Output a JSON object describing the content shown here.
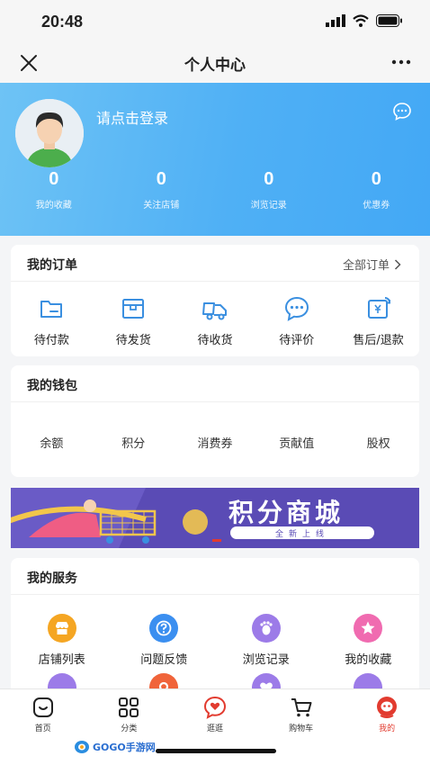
{
  "status_bar": {
    "time": "20:48"
  },
  "nav": {
    "title": "个人中心"
  },
  "profile": {
    "login_prompt": "请点击登录",
    "stats": [
      {
        "value": "0",
        "label": "我的收藏"
      },
      {
        "value": "0",
        "label": "关注店铺"
      },
      {
        "value": "0",
        "label": "浏览记录"
      },
      {
        "value": "0",
        "label": "优惠券"
      }
    ]
  },
  "orders": {
    "title": "我的订单",
    "all_link": "全部订单",
    "items": [
      {
        "label": "待付款",
        "icon": "wallet-icon"
      },
      {
        "label": "待发货",
        "icon": "package-icon"
      },
      {
        "label": "待收货",
        "icon": "truck-icon"
      },
      {
        "label": "待评价",
        "icon": "comment-icon"
      },
      {
        "label": "售后/退款",
        "icon": "refund-icon"
      }
    ]
  },
  "wallet": {
    "title": "我的钱包",
    "items": [
      "余额",
      "积分",
      "消费券",
      "贡献值",
      "股权"
    ]
  },
  "banner": {
    "title": "积分商城",
    "subtitle": "全新上线"
  },
  "services": {
    "title": "我的服务",
    "items": [
      {
        "label": "店铺列表",
        "icon": "store-icon",
        "color": "#f5a623"
      },
      {
        "label": "问题反馈",
        "icon": "question-icon",
        "color": "#3b8ff0"
      },
      {
        "label": "浏览记录",
        "icon": "footprint-icon",
        "color": "#9c7be8"
      },
      {
        "label": "我的收藏",
        "icon": "star-icon",
        "color": "#f06bb0"
      }
    ],
    "partial_icons": [
      {
        "icon": "footprint-icon",
        "color": "#9c7be8"
      },
      {
        "icon": "location-icon",
        "color": "#f0643a"
      },
      {
        "icon": "heart-icon",
        "color": "#9c7be8"
      },
      {
        "icon": "footprint-icon",
        "color": "#9c7be8"
      }
    ]
  },
  "tabbar": {
    "items": [
      {
        "label": "首页",
        "icon": "home-icon"
      },
      {
        "label": "分类",
        "icon": "category-icon"
      },
      {
        "label": "逛逛",
        "icon": "browse-icon"
      },
      {
        "label": "购物车",
        "icon": "cart-icon"
      },
      {
        "label": "我的",
        "icon": "user-icon",
        "active": true
      }
    ]
  },
  "watermark": {
    "text": "GOGO手游网"
  },
  "colors": {
    "accent": "#3a8fe0",
    "header_gradient_start": "#6ec3f5",
    "header_gradient_end": "#43a8f5",
    "active_tab": "#e23b2f"
  }
}
